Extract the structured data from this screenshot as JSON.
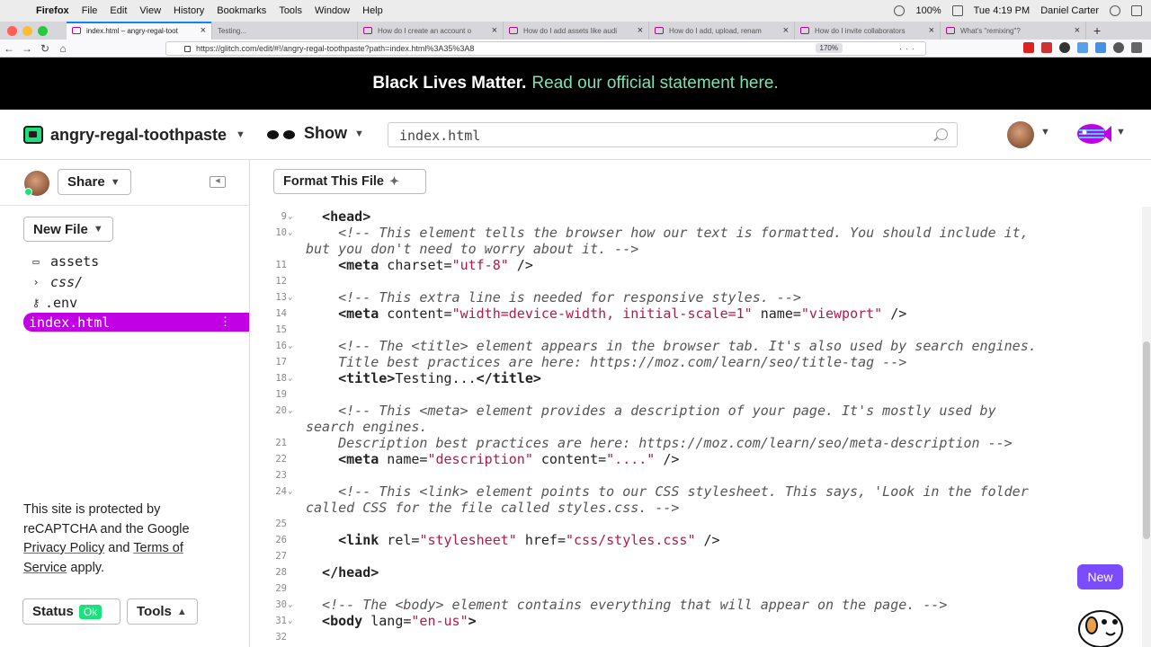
{
  "menubar": {
    "app_name": "Firefox",
    "items": [
      "File",
      "Edit",
      "View",
      "History",
      "Bookmarks",
      "Tools",
      "Window",
      "Help"
    ],
    "battery": "100%",
    "clock": "Tue 4:19 PM",
    "user": "Daniel Carter"
  },
  "tabs": [
    {
      "label": "index.html – angry-regal-toot",
      "active": true
    },
    {
      "label": "Testing...",
      "active": false
    },
    {
      "label": "How do I create an account o",
      "active": false
    },
    {
      "label": "How do I add assets like audi",
      "active": false
    },
    {
      "label": "How do I add, upload, renam",
      "active": false
    },
    {
      "label": "How do I invite collaborators",
      "active": false
    },
    {
      "label": "What's \"remixing\"?",
      "active": false
    }
  ],
  "nav": {
    "url": "https://glitch.com/edit/#!/angry-regal-toothpaste?path=index.html%3A35%3A8",
    "zoom": "170%"
  },
  "banner": {
    "bold_text": "Black Lives Matter.",
    "link_text": "Read our official statement here."
  },
  "header": {
    "project_name": "angry-regal-toothpaste",
    "show_label": "Show",
    "search_value": "index.html"
  },
  "sidebar": {
    "share_label": "Share",
    "new_file_label": "New File",
    "files": [
      {
        "name": "assets",
        "icon": "archive-icon",
        "active": false
      },
      {
        "name": "css/",
        "icon": "chevron-right-icon",
        "active": false
      },
      {
        "name": ".env",
        "icon": "key-icon",
        "active": false
      },
      {
        "name": "index.html",
        "icon": "",
        "active": true
      }
    ],
    "recaptcha_prefix": "This site is protected by reCAPTCHA and the Google",
    "privacy_link": "Privacy Policy",
    "and_text": "and",
    "terms_link": "Terms of Service",
    "apply_text": "apply.",
    "status_label": "Status",
    "status_badge": "Ok",
    "tools_label": "Tools"
  },
  "editor": {
    "format_label": "Format This File",
    "lines": [
      {
        "n": "9",
        "fold": true,
        "parts": [
          [
            "t",
            "  <head>"
          ]
        ]
      },
      {
        "n": "10",
        "fold": true,
        "parts": [
          [
            "c",
            "    <!-- This element tells the browser how our text is formatted. You should include it,"
          ]
        ]
      },
      {
        "n": "",
        "fold": false,
        "parts": [
          [
            "c",
            "but you don't need to worry about it. -->"
          ]
        ]
      },
      {
        "n": "11",
        "fold": false,
        "parts": [
          [
            "t",
            "    <meta"
          ],
          [
            "p",
            " charset="
          ],
          [
            "v",
            "\"utf-8\""
          ],
          [
            "p",
            " />"
          ]
        ]
      },
      {
        "n": "12",
        "fold": false,
        "parts": []
      },
      {
        "n": "13",
        "fold": true,
        "parts": [
          [
            "c",
            "    <!-- This extra line is needed for responsive styles. -->"
          ]
        ]
      },
      {
        "n": "14",
        "fold": false,
        "parts": [
          [
            "t",
            "    <meta"
          ],
          [
            "p",
            " content="
          ],
          [
            "v",
            "\"width=device-width, initial-scale=1\""
          ],
          [
            "p",
            " name="
          ],
          [
            "v",
            "\"viewport\""
          ],
          [
            "p",
            " />"
          ]
        ]
      },
      {
        "n": "15",
        "fold": false,
        "parts": []
      },
      {
        "n": "16",
        "fold": true,
        "parts": [
          [
            "c",
            "    <!-- The <title> element appears in the browser tab. It's also used by search engines."
          ]
        ]
      },
      {
        "n": "17",
        "fold": false,
        "parts": [
          [
            "c",
            "    Title best practices are here: https://moz.com/learn/seo/title-tag -->"
          ]
        ]
      },
      {
        "n": "18",
        "fold": true,
        "parts": [
          [
            "t",
            "    <title>"
          ],
          [
            "p",
            "Testing..."
          ],
          [
            "t",
            "</title>"
          ]
        ]
      },
      {
        "n": "19",
        "fold": false,
        "parts": []
      },
      {
        "n": "20",
        "fold": true,
        "parts": [
          [
            "c",
            "    <!-- This <meta> element provides a description of your page. It's mostly used by"
          ]
        ]
      },
      {
        "n": "",
        "fold": false,
        "parts": [
          [
            "c",
            "search engines."
          ]
        ]
      },
      {
        "n": "21",
        "fold": false,
        "parts": [
          [
            "c",
            "    Description best practices are here: https://moz.com/learn/seo/meta-description -->"
          ]
        ]
      },
      {
        "n": "22",
        "fold": false,
        "parts": [
          [
            "t",
            "    <meta"
          ],
          [
            "p",
            " name="
          ],
          [
            "v",
            "\"description\""
          ],
          [
            "p",
            " content="
          ],
          [
            "v",
            "\"....\""
          ],
          [
            "p",
            " />"
          ]
        ]
      },
      {
        "n": "23",
        "fold": false,
        "parts": []
      },
      {
        "n": "24",
        "fold": true,
        "parts": [
          [
            "c",
            "    <!-- This <link> element points to our CSS stylesheet. This says, 'Look in the folder"
          ]
        ]
      },
      {
        "n": "",
        "fold": false,
        "parts": [
          [
            "c",
            "called CSS for the file called styles.css. -->"
          ]
        ]
      },
      {
        "n": "25",
        "fold": false,
        "parts": []
      },
      {
        "n": "26",
        "fold": false,
        "parts": [
          [
            "t",
            "    <link"
          ],
          [
            "p",
            " rel="
          ],
          [
            "v",
            "\"stylesheet\""
          ],
          [
            "p",
            " href="
          ],
          [
            "v",
            "\"css/styles.css\""
          ],
          [
            "p",
            " />"
          ]
        ]
      },
      {
        "n": "27",
        "fold": false,
        "parts": []
      },
      {
        "n": "28",
        "fold": false,
        "parts": [
          [
            "t",
            "  </head>"
          ]
        ]
      },
      {
        "n": "29",
        "fold": false,
        "parts": []
      },
      {
        "n": "30",
        "fold": true,
        "parts": [
          [
            "c",
            "  <!-- The <body> element contains everything that will appear on the page. -->"
          ]
        ]
      },
      {
        "n": "31",
        "fold": true,
        "parts": [
          [
            "t",
            "  <body"
          ],
          [
            "p",
            " lang="
          ],
          [
            "v",
            "\"en-us\""
          ],
          [
            "t",
            ">"
          ]
        ]
      },
      {
        "n": "32",
        "fold": false,
        "parts": []
      }
    ]
  },
  "new_badge": "New",
  "colors": {
    "accent_purple": "#c100e6",
    "ok_green": "#19e27a",
    "banner_link": "#7ce2b4",
    "new_badge": "#7a4bff"
  }
}
